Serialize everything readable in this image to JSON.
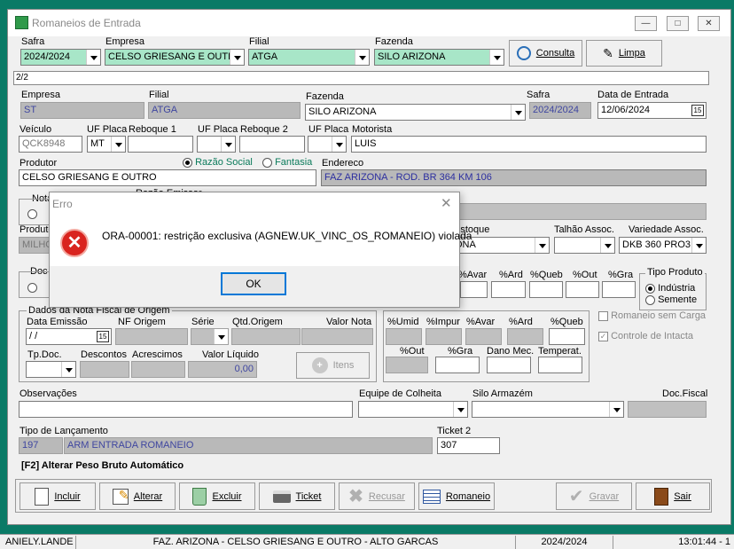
{
  "window": {
    "title": "Romaneios de Entrada"
  },
  "filter": {
    "safra_label": "Safra",
    "safra": "2024/2024",
    "empresa_label": "Empresa",
    "empresa": "CELSO GRIESANG E OUTRO",
    "filial_label": "Filial",
    "filial": "ATGA",
    "fazenda_label": "Fazenda",
    "fazenda": "SILO ARIZONA",
    "consulta_label": "Consulta",
    "limpa_label": "Limpa"
  },
  "record_counter": "2/2",
  "form": {
    "empresa_label": "Empresa",
    "empresa": "ST",
    "filial_label": "Filial",
    "filial": "ATGA",
    "fazenda_label": "Fazenda",
    "fazenda": "SILO ARIZONA",
    "safra_label": "Safra",
    "safra": "2024/2024",
    "data_entrada_label": "Data de Entrada",
    "data_entrada": "12/06/2024",
    "veiculo_label": "Veículo",
    "veiculo": "QCK8948",
    "uf_placa_label": "UF Placa",
    "uf_placa": "MT",
    "reboque1_label": "Reboque 1",
    "uf_placa2_label": "UF Placa",
    "reboque2_label": "Reboque 2",
    "uf_placa3_label": "UF Placa",
    "motorista_label": "Motorista",
    "motorista": "LUIS",
    "produtor_label": "Produtor",
    "produtor": "CELSO GRIESANG E OUTRO",
    "razao_social_label": "Razão Social",
    "fantasia_label": "Fantasia",
    "endereco_label": "Endereco",
    "endereco": "FAZ ARIZONA - ROD. BR 364 KM 106",
    "nota_label": "Nota",
    "razao_emissor_label": "Razão Emissor",
    "produto_label": "Produto",
    "produto": "MILHO",
    "estoque_label": "Estoque",
    "estoque": "ONA",
    "talhao_label": "Talhão Assoc.",
    "variedade_label": "Variedade Assoc.",
    "variedade": "DKB 360 PRO3",
    "doc_label": "Doc",
    "avar_label": "%Avar",
    "ard_label": "%Ard",
    "queb_label": "%Queb",
    "out_label": "%Out",
    "gra_label": "%Gra",
    "tipo_produto_label": "Tipo Produto",
    "industria_label": "Indústria",
    "semente_label": "Semente",
    "dados_nota_label": "Dados da Nota Fiscal de Origem",
    "data_emissao_label": "Data Emissão",
    "data_emissao": " / /",
    "nf_origem_label": "NF Origem",
    "serie_label": "Série",
    "qtd_origem_label": "Qtd.Origem",
    "valor_nota_label": "Valor Nota",
    "tp_doc_label": "Tp.Doc.",
    "descontos_label": "Descontos",
    "acrescimos_label": "Acrescimos",
    "valor_liquido_label": "Valor Líquido",
    "valor_liquido": "0,00",
    "itens_label": "Itens",
    "umid_label": "%Umid",
    "impur_label": "%Impur",
    "avar2_label": "%Avar",
    "ard2_label": "%Ard",
    "queb2_label": "%Queb",
    "out2_label": "%Out",
    "gra2_label": "%Gra",
    "dano_label": "Dano Mec.",
    "temperat_label": "Temperat.",
    "romaneio_sem_carga_label": "Romaneio sem Carga",
    "controle_intacta_label": "Controle de Intacta",
    "observacoes_label": "Observações",
    "equipe_label": "Equipe de Colheita",
    "silo_label": "Silo Armazém",
    "doc_fiscal_label": "Doc.Fiscal",
    "tipo_lanc_label": "Tipo de Lançamento",
    "tipo_lanc_code": "197",
    "tipo_lanc_desc": "ARM ENTRADA ROMANEIO",
    "ticket2_label": "Ticket 2",
    "ticket2": "307",
    "f2_hint": "[F2] Alterar Peso Bruto Automático"
  },
  "toolbar": {
    "incluir": "Incluir",
    "alterar": "Alterar",
    "excluir": "Excluir",
    "ticket": "Ticket",
    "recusar": "Recusar",
    "romaneio": "Romaneio",
    "gravar": "Gravar",
    "sair": "Sair"
  },
  "dialog": {
    "title": "Erro",
    "message": "ORA-00001: restrição exclusiva (AGNEW.UK_VINC_OS_ROMANEIO) violada",
    "ok": "OK"
  },
  "statusbar": {
    "user": "ANIELY.LANDE",
    "context": "FAZ. ARIZONA - CELSO GRIESANG E OUTRO - ALTO GARCAS",
    "safra": "2024/2024",
    "time": "13:01:44 - 1"
  }
}
